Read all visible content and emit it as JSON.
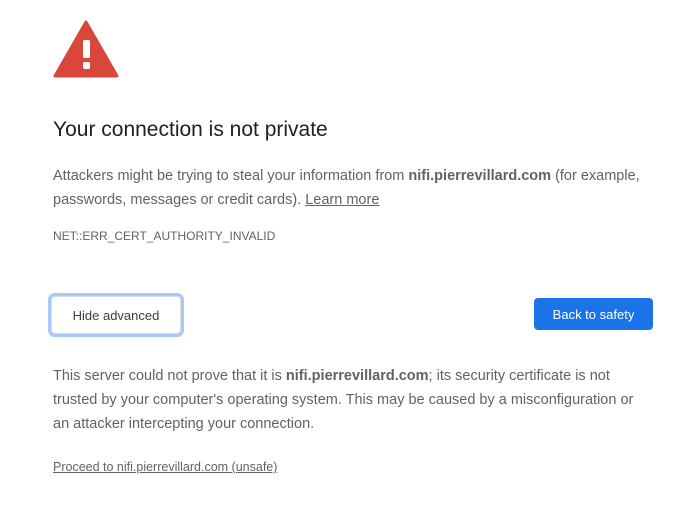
{
  "icon": {
    "name": "warning-triangle-icon",
    "color": "#d9463a"
  },
  "heading": "Your connection is not private",
  "main_message": {
    "before_host": "Attackers might be trying to steal your information from ",
    "host": "nifi.pierrevillard.com",
    "after_host": " (for example, passwords, messages or credit cards). ",
    "learn_more": "Learn more"
  },
  "error_code": "NET::ERR_CERT_AUTHORITY_INVALID",
  "buttons": {
    "hide_advanced": "Hide advanced",
    "back_to_safety": "Back to safety"
  },
  "details": {
    "before_host": "This server could not prove that it is ",
    "host": "nifi.pierrevillard.com",
    "after_host": "; its security certificate is not trusted by your computer's operating system. This may be caused by a misconfiguration or an attacker intercepting your connection."
  },
  "proceed_link": "Proceed to nifi.pierrevillard.com (unsafe)",
  "colors": {
    "primary_blue": "#1a73e8",
    "warning_red": "#d9463a",
    "focus_ring": "#a8c7fa"
  }
}
